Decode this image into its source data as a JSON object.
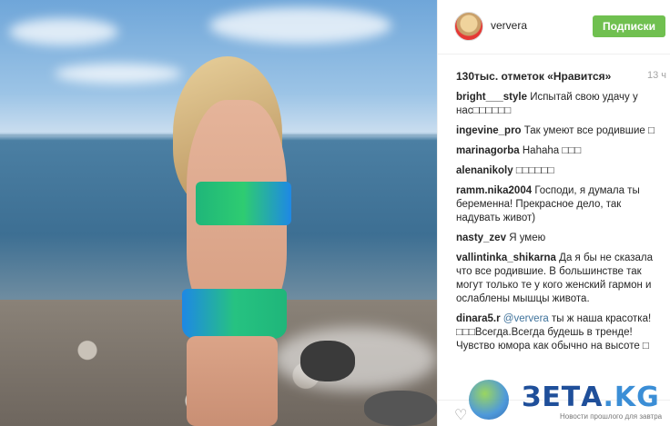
{
  "post": {
    "username": "ververa",
    "follow_label": "Подписки",
    "likes_text": "130тыс. отметок «Нравится»",
    "time_ago": "13 ч"
  },
  "comments": [
    {
      "user": "bright___style",
      "text": "Испытай свою удачу у нас□□□□□□"
    },
    {
      "user": "ingevine_pro",
      "text": "Так умеют все родившие □"
    },
    {
      "user": "marinagorba",
      "text": "Hahaha □□□"
    },
    {
      "user": "alenanikoly",
      "text": "□□□□□□"
    },
    {
      "user": "ramm.nika2004",
      "text": "Господи, я думала ты беременна! Прекрасное дело, так надувать живот)"
    },
    {
      "user": "nasty_zev",
      "text": "Я умею"
    },
    {
      "user": "vallintinka_shikarna",
      "text": "Да я бы не сказала что все родившие. В большинстве так могут только те у кого женский гармон и ослаблены мышцы живота."
    },
    {
      "user": "dinara5.r",
      "mention": "@ververa",
      "text": "ты ж наша красотка! □□□Всегда.Всегда будешь в тренде! Чувство юмора как обычно на высоте □"
    }
  ],
  "watermark": {
    "brand": "ЗЕТА",
    "suffix": ".KG",
    "tagline": "Новости прошлого для завтра"
  },
  "icons": {
    "heart": "heart-icon",
    "avatar": "avatar",
    "globe": "globe-logo-icon"
  }
}
